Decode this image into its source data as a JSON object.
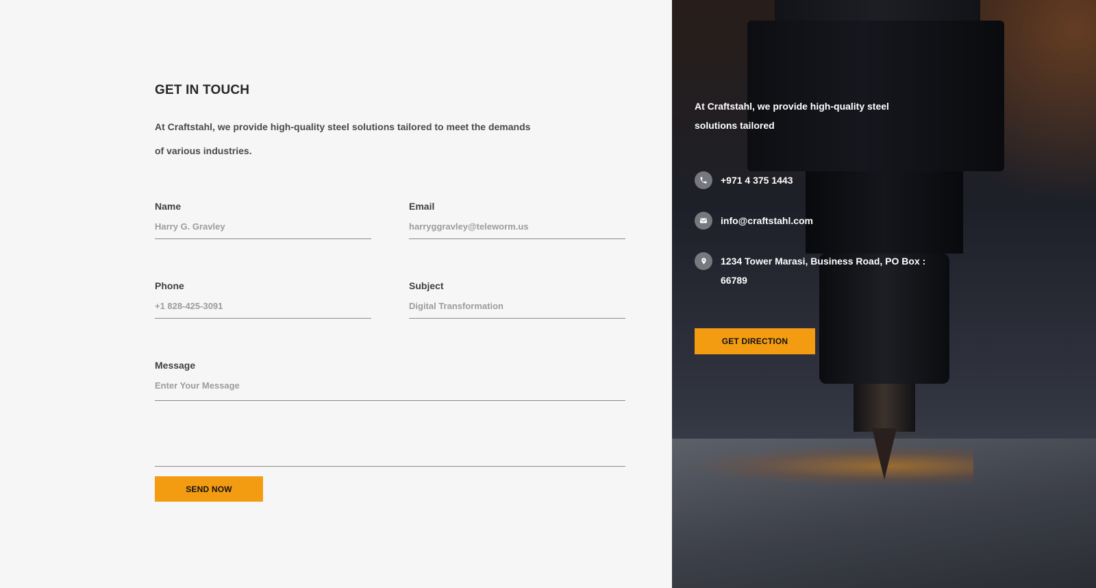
{
  "contact_section": {
    "title": "GET IN TOUCH",
    "intro": "At Craftstahl, we provide high-quality steel solutions tailored to meet the demands of various industries."
  },
  "form": {
    "name": {
      "label": "Name",
      "placeholder": "Harry G. Gravley"
    },
    "email": {
      "label": "Email",
      "placeholder": "harryggravley@teleworm.us"
    },
    "phone": {
      "label": "Phone",
      "placeholder": "+1 828-425-3091"
    },
    "subject": {
      "label": "Subject",
      "placeholder": "Digital Transformation"
    },
    "message": {
      "label": "Message",
      "placeholder": "Enter Your Message"
    },
    "submit_label": "SEND NOW"
  },
  "info_panel": {
    "description": "At Craftstahl, we provide high-quality steel solutions tailored",
    "phone": "+971 4 375 1443",
    "email": "info@craftstahl.com",
    "address": "1234 Tower Marasi, Business Road, PO Box : 66789",
    "direction_label": "GET DIRECTION",
    "icons": [
      "phone-icon",
      "mail-icon",
      "location-pin-icon"
    ]
  },
  "colors": {
    "accent": "#f39c12",
    "background": "#f6f6f6",
    "heading": "#262626"
  }
}
